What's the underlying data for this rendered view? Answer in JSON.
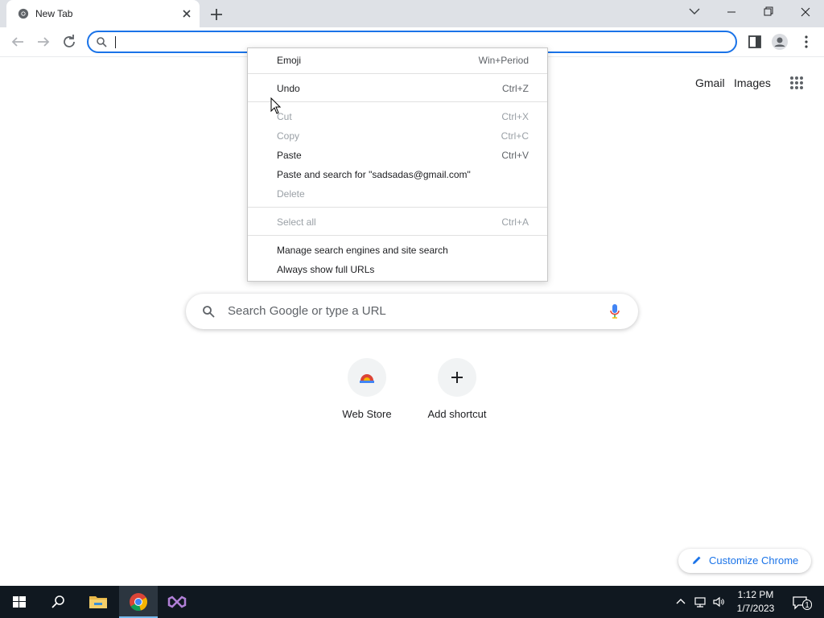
{
  "tab": {
    "title": "New Tab"
  },
  "omnibox": {
    "value": ""
  },
  "ntp": {
    "links": {
      "gmail": "Gmail",
      "images": "Images"
    },
    "search_placeholder": "Search Google or type a URL",
    "shortcuts": [
      {
        "label": "Web Store"
      },
      {
        "label": "Add shortcut"
      }
    ],
    "customize_label": "Customize Chrome"
  },
  "context_menu": {
    "items": [
      {
        "label": "Emoji",
        "shortcut": "Win+Period",
        "enabled": true
      },
      {
        "label": "Undo",
        "shortcut": "Ctrl+Z",
        "enabled": true
      },
      {
        "label": "Cut",
        "shortcut": "Ctrl+X",
        "enabled": false
      },
      {
        "label": "Copy",
        "shortcut": "Ctrl+C",
        "enabled": false
      },
      {
        "label": "Paste",
        "shortcut": "Ctrl+V",
        "enabled": true
      },
      {
        "label": "Paste and search for \"sadsadas@gmail.com\"",
        "shortcut": "",
        "enabled": true
      },
      {
        "label": "Delete",
        "shortcut": "",
        "enabled": false
      },
      {
        "label": "Select all",
        "shortcut": "Ctrl+A",
        "enabled": false
      },
      {
        "label": "Manage search engines and site search",
        "shortcut": "",
        "enabled": true
      },
      {
        "label": "Always show full URLs",
        "shortcut": "",
        "enabled": true
      }
    ]
  },
  "taskbar": {
    "time": "1:12 PM",
    "date": "1/7/2023",
    "notification_count": "1"
  },
  "colors": {
    "accent": "#1a73e8",
    "tabstrip": "#dee1e6",
    "taskbar": "#101820"
  }
}
